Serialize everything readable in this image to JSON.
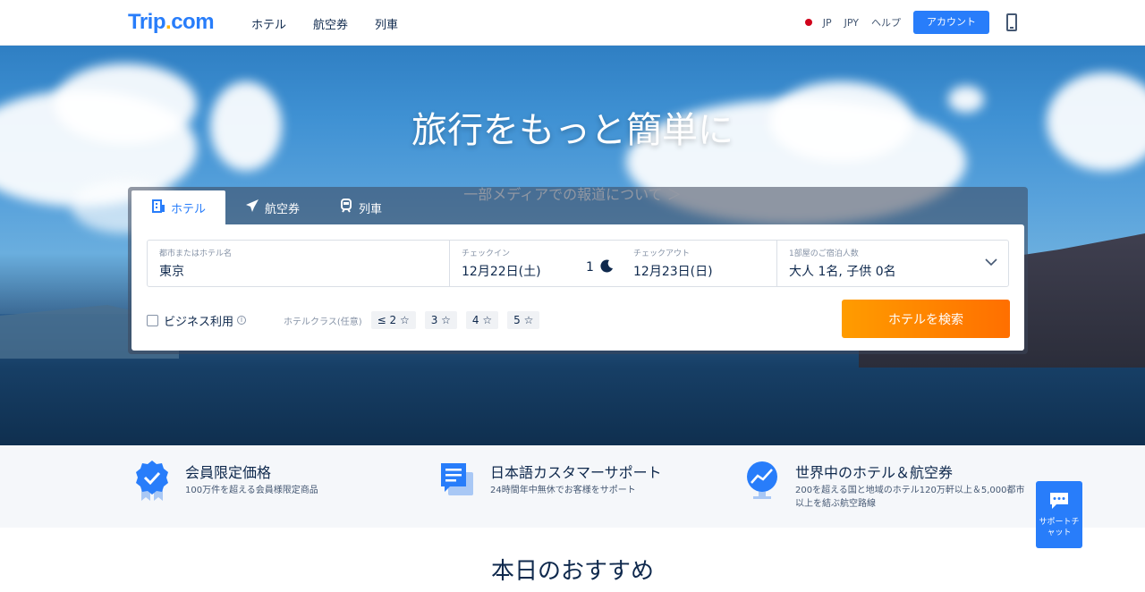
{
  "header": {
    "logo_main": "Trip",
    "logo_dot": ".",
    "logo_tail": "com",
    "nav": [
      "ホテル",
      "航空券",
      "列車"
    ],
    "lang": "JP",
    "currency": "JPY",
    "help": "ヘルプ",
    "account": "アカウント"
  },
  "hero": {
    "title": "旅行をもっと簡単に",
    "subtitle": "一部メディアでの報道について ＞"
  },
  "search": {
    "tabs": [
      {
        "label": "ホテル",
        "icon": "hotel-icon"
      },
      {
        "label": "航空券",
        "icon": "plane-icon"
      },
      {
        "label": "列車",
        "icon": "train-icon"
      }
    ],
    "destination": {
      "label": "都市またはホテル名",
      "value": "東京"
    },
    "checkin": {
      "label": "チェックイン",
      "value": "12月22日(土)"
    },
    "nights": "1",
    "checkout": {
      "label": "チェックアウト",
      "value": "12月23日(日)"
    },
    "guests": {
      "label": "1部屋のご宿泊人数",
      "value": "大人 1名, 子供 0名"
    },
    "business": "ビジネス利用",
    "class_label": "ホテルクラス(任意)",
    "stars": [
      "≤ 2 ☆",
      "3 ☆",
      "4 ☆",
      "5 ☆"
    ],
    "button": "ホテルを検索"
  },
  "features": [
    {
      "title": "会員限定価格",
      "desc": "100万件を超える会員様限定商品",
      "icon": "badge-check-icon"
    },
    {
      "title": "日本語カスタマーサポート",
      "desc": "24時間年中無休でお客様をサポート",
      "icon": "chat-document-icon"
    },
    {
      "title": "世界中のホテル＆航空券",
      "desc": "200を超える国と地域のホテル120万軒以上＆5,000都市以上を結ぶ航空路線",
      "icon": "globe-chart-icon"
    }
  ],
  "support": {
    "label": "サポートチャット"
  },
  "recommend_title": "本日のおすすめ",
  "colors": {
    "brand": "#287dfa",
    "search_button": "#ff7a00"
  }
}
